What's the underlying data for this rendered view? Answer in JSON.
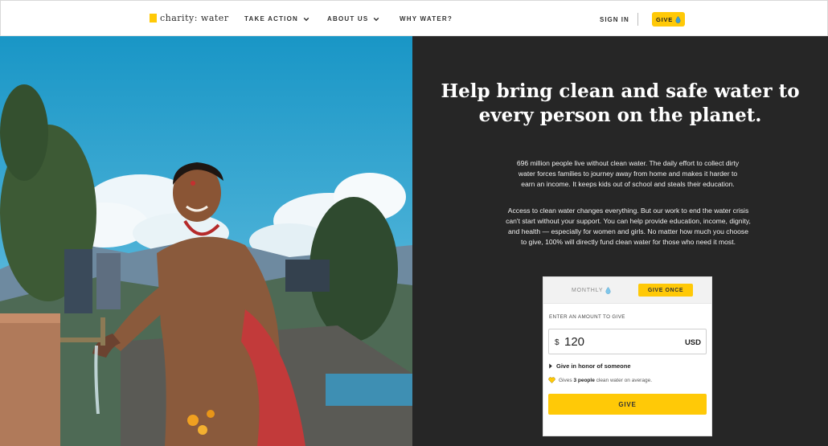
{
  "colors": {
    "brand_yellow": "#ffc907",
    "panel_dark": "#262626",
    "text_dark": "#222222",
    "water_blue": "#7fc6ea"
  },
  "nav": {
    "logo_text": "charity: water",
    "items": [
      {
        "label": "TAKE ACTION",
        "icon": "chevron-down-icon"
      },
      {
        "label": "ABOUT US",
        "icon": "chevron-down-icon"
      },
      {
        "label": "WHY WATER?"
      }
    ],
    "signin_label": "SIGN IN",
    "give_label": "GIVE",
    "give_icon": "water-drop-icon"
  },
  "hero": {
    "headline": "Help bring clean and safe water to every person on the planet.",
    "paragraph1": "696 million people live without clean water. The daily effort to collect dirty water forces families to journey away from home and makes it harder to earn an income. It keeps kids out of school and steals their education.",
    "paragraph2": "Access to clean water changes everything. But our work to end the water crisis can't start without your support. You can help provide education, income, dignity, and health — especially for women and girls. No matter how much you choose to give, 100% will directly fund clean water for those who need it most."
  },
  "donation": {
    "tab_monthly": "MONTHLY",
    "tab_once": "GIVE ONCE",
    "amount_label": "ENTER AN AMOUNT TO GIVE",
    "currency_symbol": "$",
    "amount_value": "120",
    "currency_code": "USD",
    "honor_label": "Give in honor of someone",
    "impact_prefix": "Gives",
    "impact_people": "3 people",
    "impact_suffix": "clean water on average.",
    "give_button": "GIVE"
  }
}
